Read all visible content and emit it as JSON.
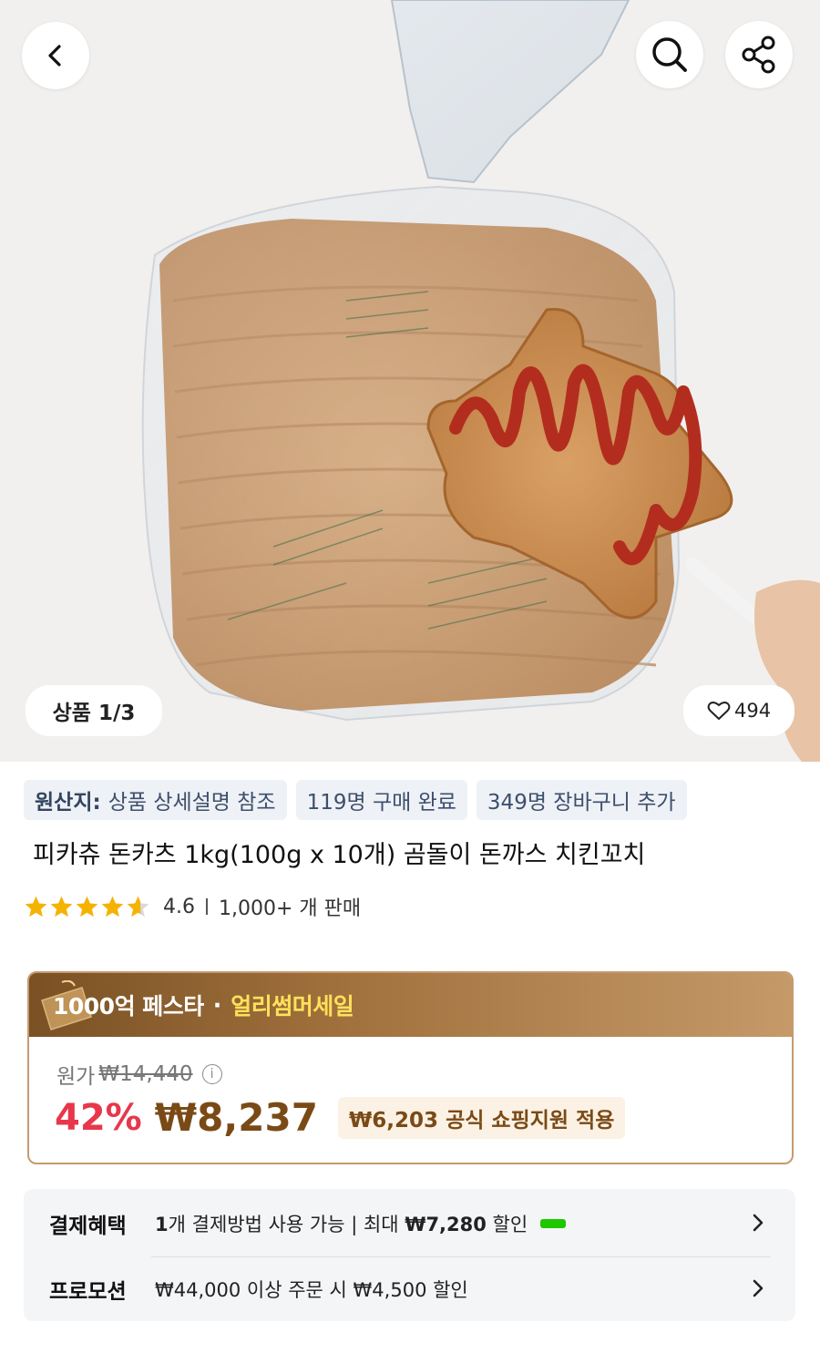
{
  "hero": {
    "page_indicator": "상품 1/3",
    "like_count": "494"
  },
  "tags": {
    "origin_label": "원산지:",
    "origin_value": "상품 상세설명 참조",
    "purchased": "119명 구매 완료",
    "cart_added": "349명 장바구니 추가"
  },
  "product": {
    "title": "피카츄 돈카츠 1kg(100g x 10개) 곰돌이 돈까스 치킨꼬치",
    "rating": "4.6",
    "rating_value": 4.6,
    "sales": "1,000+ 개 판매"
  },
  "price": {
    "promo_fest": "1000억 페스타",
    "promo_dot": "·",
    "promo_sale": "얼리썸머세일",
    "original_label": "원가",
    "original_price": "₩14,440",
    "info_icon": "i",
    "discount": "42%",
    "final_price": "₩8,237",
    "support_text": "₩6,203 공식 쇼핑지원 적용"
  },
  "benefits": {
    "payment_label": "결제혜택",
    "payment_count": "1",
    "payment_text": "개 결제방법 사용 가능 | 최대 ",
    "payment_amount": "₩7,280",
    "payment_suffix": " 할인",
    "promotion_label": "프로모션",
    "promotion_text": "₩44,000 이상 주문 시 ₩4,500 할인"
  },
  "colors": {
    "discount": "#e8374b",
    "price_brown": "#7a4a16",
    "promo_yellow": "#ffe15a",
    "tag_bg": "#eef1f6",
    "star": "#f5b301"
  },
  "icons": [
    "back-arrow-icon",
    "search-icon",
    "share-icon",
    "heart-icon",
    "star-icon",
    "info-icon",
    "chevron-right-icon",
    "ticket-icon",
    "naverpay-logo"
  ]
}
